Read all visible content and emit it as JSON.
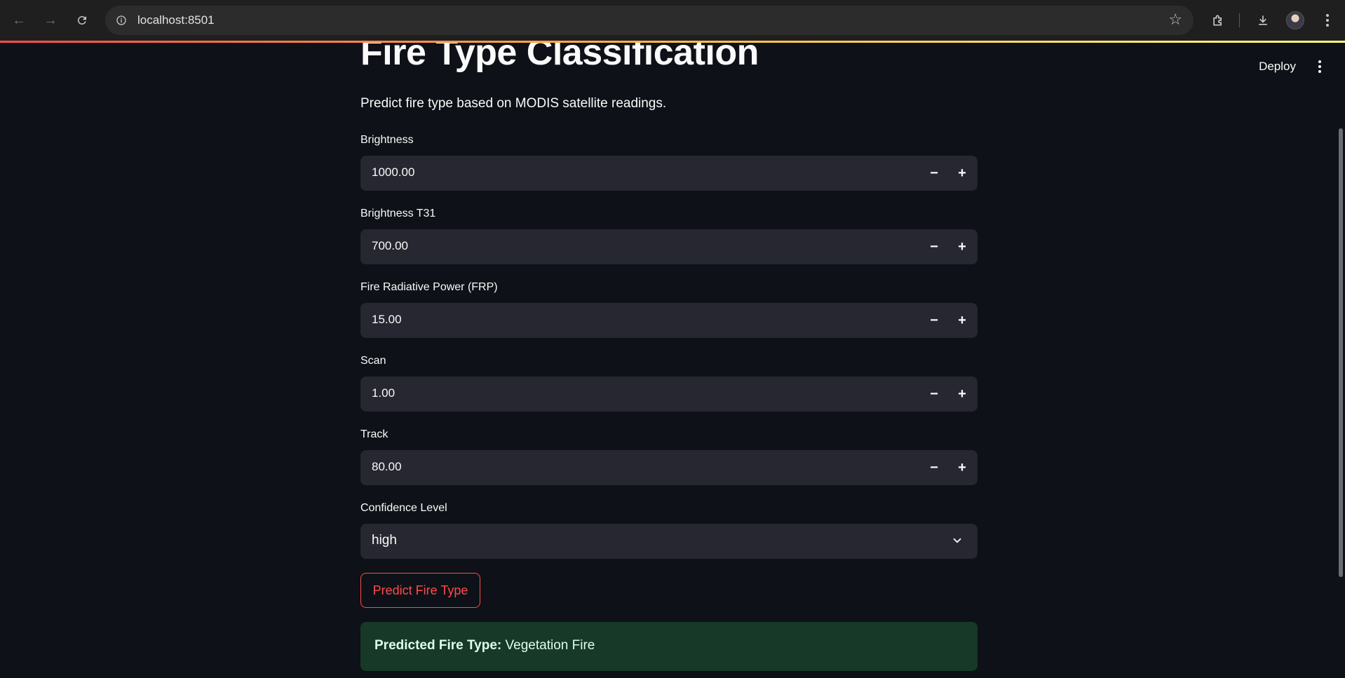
{
  "browser": {
    "url": "localhost:8501"
  },
  "app": {
    "deploy_label": "Deploy",
    "title": "Fire Type Classification",
    "subtitle": "Predict fire type based on MODIS satellite readings.",
    "fields": [
      {
        "label": "Brightness",
        "value": "1000.00"
      },
      {
        "label": "Brightness T31",
        "value": "700.00"
      },
      {
        "label": "Fire Radiative Power (FRP)",
        "value": "15.00"
      },
      {
        "label": "Scan",
        "value": "1.00"
      },
      {
        "label": "Track",
        "value": "80.00"
      }
    ],
    "confidence": {
      "label": "Confidence Level",
      "value": "high"
    },
    "predict_button": "Predict Fire Type",
    "result": {
      "prefix": "Predicted Fire Type:",
      "value": "Vegetation Fire"
    }
  },
  "colors": {
    "background": "#0e1117",
    "input_bg": "#262730",
    "accent": "#ff4b4b",
    "success_bg": "#173928"
  }
}
